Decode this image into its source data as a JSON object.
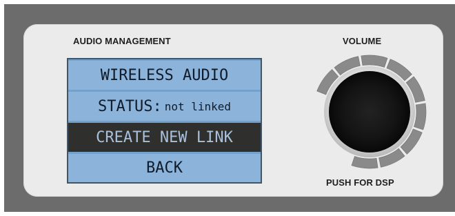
{
  "audio_management": {
    "title": "AUDIO MANAGEMENT"
  },
  "lcd_menu": {
    "items": [
      {
        "label": "WIRELESS AUDIO",
        "selected": false
      },
      {
        "label_key": "STATUS:",
        "label_value": "not linked",
        "selected": false
      },
      {
        "label": "CREATE NEW LINK",
        "selected": true
      },
      {
        "label": "BACK",
        "selected": false
      }
    ]
  },
  "volume": {
    "title": "VOLUME",
    "caption": "PUSH FOR DSP",
    "level_segments_lit": 0,
    "level_segments_total": 9
  },
  "colors": {
    "lcd_background": "#8cb3da",
    "lcd_highlight": "#2f2f2d",
    "panel": "#ebebeb",
    "knob": "#121212"
  },
  "icons": [
    "volume-knob-icon",
    "volume-level-segment-icon"
  ]
}
